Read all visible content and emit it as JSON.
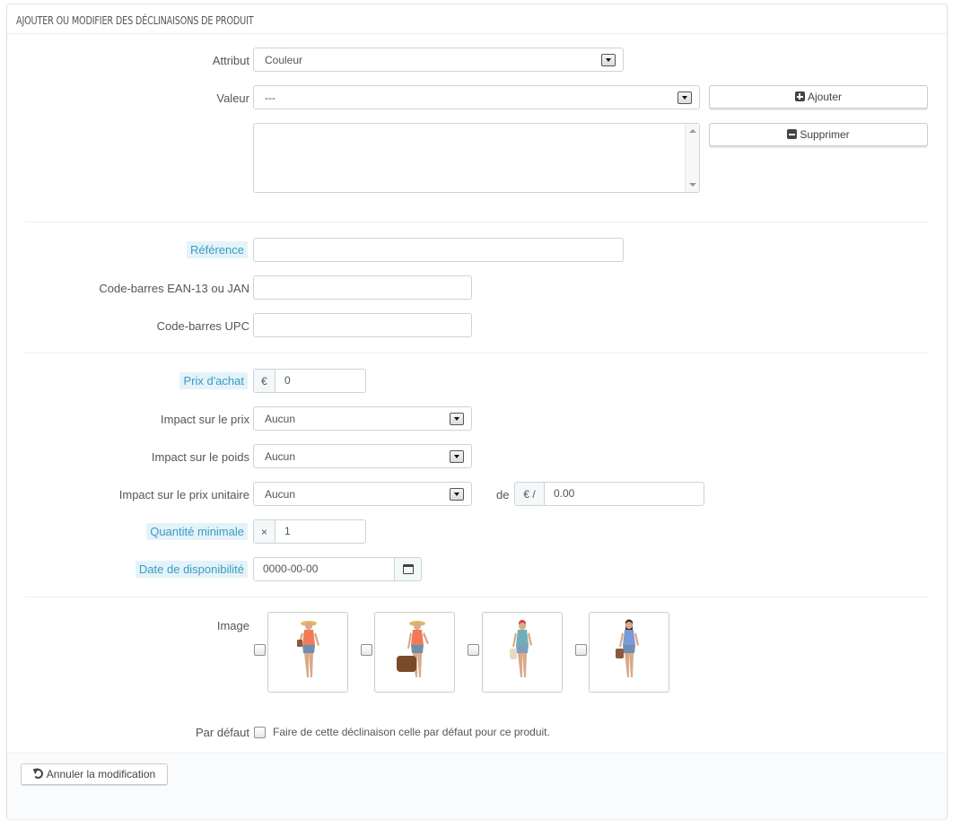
{
  "panel": {
    "title": "AJOUTER OU MODIFIER DES DÉCLINAISONS DE PRODUIT"
  },
  "attribut": {
    "label": "Attribut",
    "value": "Couleur"
  },
  "valeur": {
    "label": "Valeur",
    "value": "---"
  },
  "buttons": {
    "ajouter": "Ajouter",
    "supprimer": "Supprimer",
    "annuler": "Annuler la modification"
  },
  "reference": {
    "label": "Référence",
    "value": ""
  },
  "ean13": {
    "label": "Code-barres EAN-13 ou JAN",
    "value": ""
  },
  "upc": {
    "label": "Code-barres UPC",
    "value": ""
  },
  "prix_achat": {
    "label": "Prix d'achat",
    "currency": "€",
    "value": "0"
  },
  "impact_prix": {
    "label": "Impact sur le prix",
    "value": "Aucun"
  },
  "impact_poids": {
    "label": "Impact sur le poids",
    "value": "Aucun"
  },
  "impact_prix_unitaire": {
    "label": "Impact sur le prix unitaire",
    "value": "Aucun",
    "de_label": "de",
    "unit_prefix": "€ /",
    "unit_value": "0.00"
  },
  "quantite_minimale": {
    "label": "Quantité minimale",
    "prefix": "×",
    "value": "1"
  },
  "date_dispo": {
    "label": "Date de disponibilité",
    "value": "0000-00-00"
  },
  "image": {
    "label": "Image",
    "items": [
      "image-1",
      "image-2",
      "image-3",
      "image-4"
    ]
  },
  "par_defaut": {
    "label": "Par défaut",
    "checkbox_text": "Faire de cette déclinaison celle par défaut pour ce produit."
  },
  "colors": {
    "hint_bg": "#e4f3f9",
    "hint_text": "#3a9bc2",
    "border": "#c7d6db"
  }
}
